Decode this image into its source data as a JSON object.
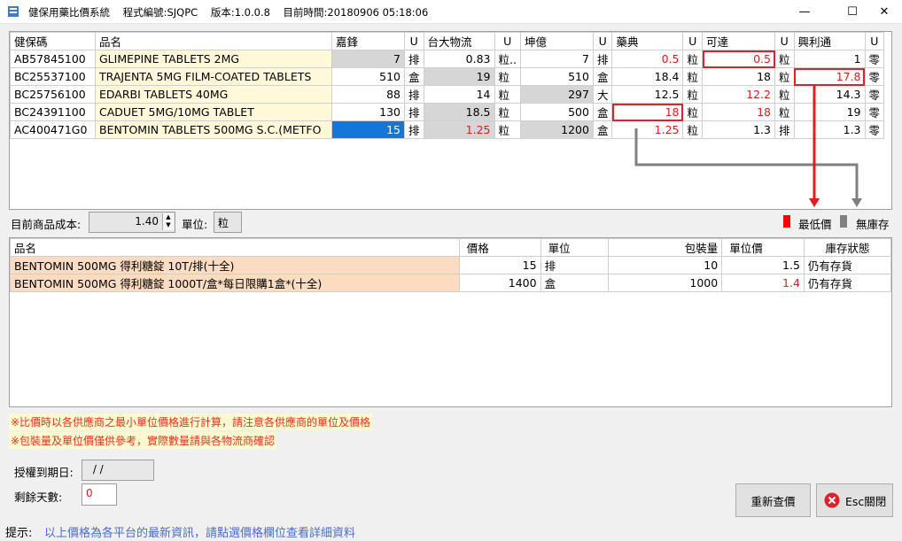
{
  "window": {
    "title": "健保用藥比價系統    程式編號:SJQPC    版本:1.0.0.8    目前時間:20180906 05:18:06",
    "minimize": "—",
    "maximize": "☐",
    "close": "✕"
  },
  "top_table": {
    "headers": [
      "健保碼",
      "品名",
      "嘉鋒",
      "U",
      "台大物流",
      "U",
      "坤億",
      "U",
      "藥典",
      "U",
      "可達",
      "U",
      "興利通",
      "U"
    ],
    "rows": [
      [
        "AB57845100",
        "GLIMEPINE TABLETS 2MG",
        "7",
        "排",
        "0.83",
        "粒..",
        "7",
        "排",
        "0.5",
        "粒",
        "0.5",
        "粒",
        "1",
        "零"
      ],
      [
        "BC25537100",
        "TRAJENTA 5MG FILM-COATED TABLETS",
        "510",
        "盒",
        "19",
        "粒",
        "510",
        "盒",
        "18.4",
        "粒",
        "18",
        "粒",
        "17.8",
        "零"
      ],
      [
        "BC25756100",
        "EDARBI TABLETS 40MG",
        "88",
        "排",
        "14",
        "粒",
        "297",
        "大",
        "12.5",
        "粒",
        "12.2",
        "粒",
        "14.3",
        "零"
      ],
      [
        "BC24391100",
        "CADUET 5MG/10MG TABLET",
        "130",
        "排",
        "18.5",
        "粒",
        "500",
        "盒",
        "18",
        "粒",
        "18",
        "粒",
        "19",
        "零"
      ],
      [
        "AC400471G0",
        "BENTOMIN TABLETS 500MG S.C.(METFO",
        "15",
        "排",
        "1.25",
        "粒",
        "1200",
        "盒",
        "1.25",
        "粒",
        "1.3",
        "排",
        "1.3",
        "零"
      ]
    ]
  },
  "cost": {
    "label": "目前商品成本:",
    "value": "1.40",
    "unit_label": "單位:",
    "unit_value": "粒"
  },
  "legend": {
    "lowest": "最低價",
    "no_stock": "無庫存",
    "lowest_color": "#ff0000",
    "no_stock_color": "#808080"
  },
  "bottom_table": {
    "headers": [
      "品名",
      "價格",
      "單位",
      "包裝量",
      "單位價",
      "庫存狀態"
    ],
    "rows": [
      [
        "BENTOMIN 500MG 得利糖錠 10T/排(十全)",
        "15",
        "排",
        "10",
        "1.5",
        "仍有存貨"
      ],
      [
        "BENTOMIN 500MG 得利糖錠 1000T/盒*每日限購1盒*(十全)",
        "1400",
        "盒",
        "1000",
        "1.4",
        "仍有存貨"
      ]
    ]
  },
  "notes": [
    "※比價時以各供應商之最小單位價格進行計算，請注意各供應商的單位及價格",
    "※包裝量及單位價僅供參考，實際數量請與各物流商確認"
  ],
  "auth": {
    "expiry_label": "授權到期日:",
    "expiry_value": " / /",
    "days_label": "剩餘天數:",
    "days_value": "0"
  },
  "buttons": {
    "requery": "重新查價",
    "close": "Esc關閉"
  },
  "status": {
    "label": "提示:",
    "text": "以上價格為各平台的最新資訊，請點選價格欄位查看詳細資料"
  }
}
